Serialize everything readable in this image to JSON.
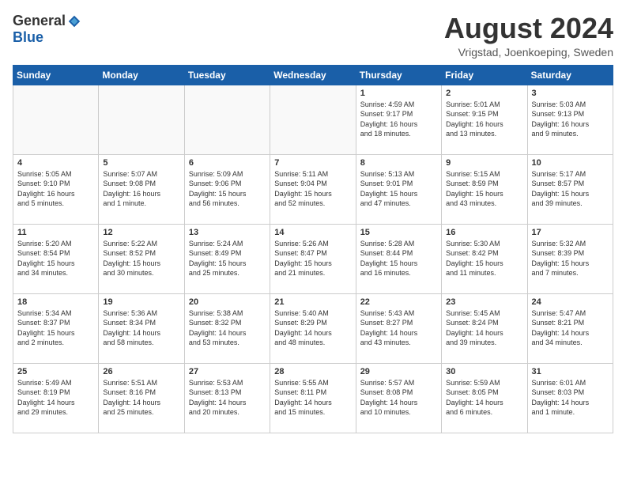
{
  "logo": {
    "general": "General",
    "blue": "Blue"
  },
  "header": {
    "title": "August 2024",
    "subtitle": "Vrigstad, Joenkoeping, Sweden"
  },
  "weekdays": [
    "Sunday",
    "Monday",
    "Tuesday",
    "Wednesday",
    "Thursday",
    "Friday",
    "Saturday"
  ],
  "weeks": [
    [
      {
        "day": "",
        "info": ""
      },
      {
        "day": "",
        "info": ""
      },
      {
        "day": "",
        "info": ""
      },
      {
        "day": "",
        "info": ""
      },
      {
        "day": "1",
        "info": "Sunrise: 4:59 AM\nSunset: 9:17 PM\nDaylight: 16 hours\nand 18 minutes."
      },
      {
        "day": "2",
        "info": "Sunrise: 5:01 AM\nSunset: 9:15 PM\nDaylight: 16 hours\nand 13 minutes."
      },
      {
        "day": "3",
        "info": "Sunrise: 5:03 AM\nSunset: 9:13 PM\nDaylight: 16 hours\nand 9 minutes."
      }
    ],
    [
      {
        "day": "4",
        "info": "Sunrise: 5:05 AM\nSunset: 9:10 PM\nDaylight: 16 hours\nand 5 minutes."
      },
      {
        "day": "5",
        "info": "Sunrise: 5:07 AM\nSunset: 9:08 PM\nDaylight: 16 hours\nand 1 minute."
      },
      {
        "day": "6",
        "info": "Sunrise: 5:09 AM\nSunset: 9:06 PM\nDaylight: 15 hours\nand 56 minutes."
      },
      {
        "day": "7",
        "info": "Sunrise: 5:11 AM\nSunset: 9:04 PM\nDaylight: 15 hours\nand 52 minutes."
      },
      {
        "day": "8",
        "info": "Sunrise: 5:13 AM\nSunset: 9:01 PM\nDaylight: 15 hours\nand 47 minutes."
      },
      {
        "day": "9",
        "info": "Sunrise: 5:15 AM\nSunset: 8:59 PM\nDaylight: 15 hours\nand 43 minutes."
      },
      {
        "day": "10",
        "info": "Sunrise: 5:17 AM\nSunset: 8:57 PM\nDaylight: 15 hours\nand 39 minutes."
      }
    ],
    [
      {
        "day": "11",
        "info": "Sunrise: 5:20 AM\nSunset: 8:54 PM\nDaylight: 15 hours\nand 34 minutes."
      },
      {
        "day": "12",
        "info": "Sunrise: 5:22 AM\nSunset: 8:52 PM\nDaylight: 15 hours\nand 30 minutes."
      },
      {
        "day": "13",
        "info": "Sunrise: 5:24 AM\nSunset: 8:49 PM\nDaylight: 15 hours\nand 25 minutes."
      },
      {
        "day": "14",
        "info": "Sunrise: 5:26 AM\nSunset: 8:47 PM\nDaylight: 15 hours\nand 21 minutes."
      },
      {
        "day": "15",
        "info": "Sunrise: 5:28 AM\nSunset: 8:44 PM\nDaylight: 15 hours\nand 16 minutes."
      },
      {
        "day": "16",
        "info": "Sunrise: 5:30 AM\nSunset: 8:42 PM\nDaylight: 15 hours\nand 11 minutes."
      },
      {
        "day": "17",
        "info": "Sunrise: 5:32 AM\nSunset: 8:39 PM\nDaylight: 15 hours\nand 7 minutes."
      }
    ],
    [
      {
        "day": "18",
        "info": "Sunrise: 5:34 AM\nSunset: 8:37 PM\nDaylight: 15 hours\nand 2 minutes."
      },
      {
        "day": "19",
        "info": "Sunrise: 5:36 AM\nSunset: 8:34 PM\nDaylight: 14 hours\nand 58 minutes."
      },
      {
        "day": "20",
        "info": "Sunrise: 5:38 AM\nSunset: 8:32 PM\nDaylight: 14 hours\nand 53 minutes."
      },
      {
        "day": "21",
        "info": "Sunrise: 5:40 AM\nSunset: 8:29 PM\nDaylight: 14 hours\nand 48 minutes."
      },
      {
        "day": "22",
        "info": "Sunrise: 5:43 AM\nSunset: 8:27 PM\nDaylight: 14 hours\nand 43 minutes."
      },
      {
        "day": "23",
        "info": "Sunrise: 5:45 AM\nSunset: 8:24 PM\nDaylight: 14 hours\nand 39 minutes."
      },
      {
        "day": "24",
        "info": "Sunrise: 5:47 AM\nSunset: 8:21 PM\nDaylight: 14 hours\nand 34 minutes."
      }
    ],
    [
      {
        "day": "25",
        "info": "Sunrise: 5:49 AM\nSunset: 8:19 PM\nDaylight: 14 hours\nand 29 minutes."
      },
      {
        "day": "26",
        "info": "Sunrise: 5:51 AM\nSunset: 8:16 PM\nDaylight: 14 hours\nand 25 minutes."
      },
      {
        "day": "27",
        "info": "Sunrise: 5:53 AM\nSunset: 8:13 PM\nDaylight: 14 hours\nand 20 minutes."
      },
      {
        "day": "28",
        "info": "Sunrise: 5:55 AM\nSunset: 8:11 PM\nDaylight: 14 hours\nand 15 minutes."
      },
      {
        "day": "29",
        "info": "Sunrise: 5:57 AM\nSunset: 8:08 PM\nDaylight: 14 hours\nand 10 minutes."
      },
      {
        "day": "30",
        "info": "Sunrise: 5:59 AM\nSunset: 8:05 PM\nDaylight: 14 hours\nand 6 minutes."
      },
      {
        "day": "31",
        "info": "Sunrise: 6:01 AM\nSunset: 8:03 PM\nDaylight: 14 hours\nand 1 minute."
      }
    ]
  ]
}
